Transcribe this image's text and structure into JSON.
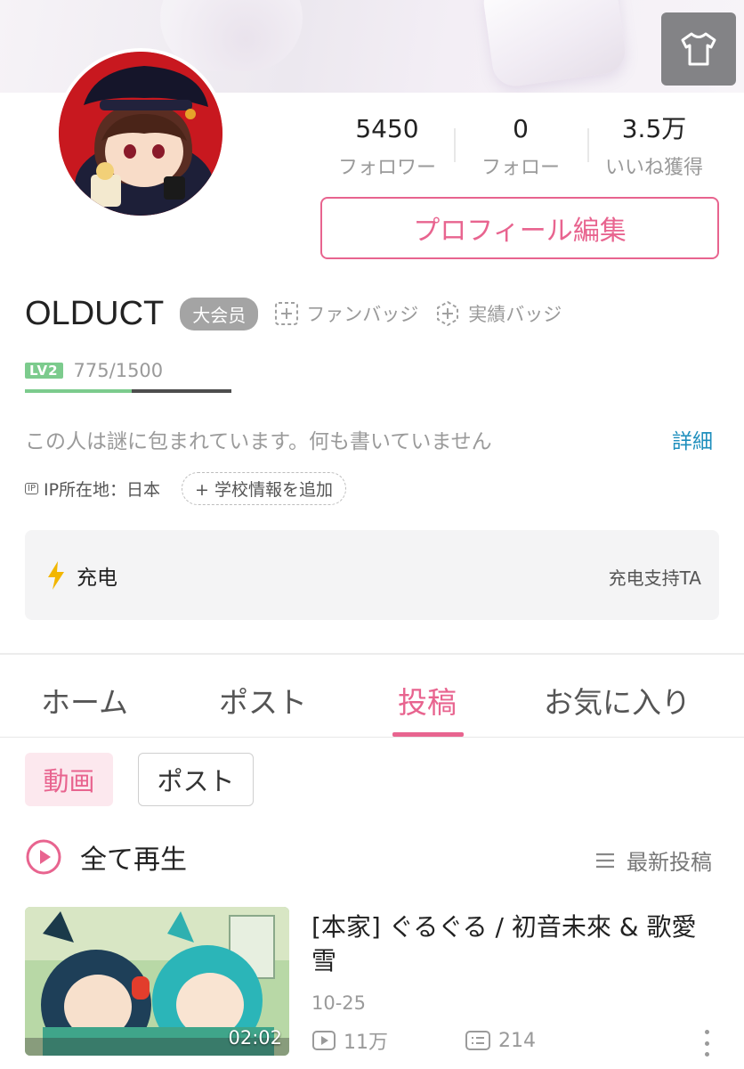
{
  "header": {
    "shirt_icon": "tshirt-icon"
  },
  "profile": {
    "stats": [
      {
        "value": "5450",
        "label": "フォロワー"
      },
      {
        "value": "0",
        "label": "フォロー"
      },
      {
        "value": "3.5万",
        "label": "いいね獲得"
      }
    ],
    "edit_button": "プロフィール編集",
    "username": "OLDUCT",
    "vip_badge": "大会员",
    "fan_badge": "ファンバッジ",
    "achievement_badge": "実績バッジ",
    "level_tag": "LV2",
    "exp": "775/1500",
    "exp_progress": 0.517,
    "bio": "この人は謎に包まれています。何も書いていません",
    "detail_link": "詳細",
    "ip_icon": "IP",
    "ip_location": "IP所在地：日本",
    "school_button": "+ 学校情報を追加"
  },
  "charge": {
    "label": "充电",
    "action": "充电支持TA",
    "accent": "#f2b600"
  },
  "tabs": [
    {
      "label": "ホーム",
      "active": false
    },
    {
      "label": "ポスト",
      "active": false
    },
    {
      "label": "投稿",
      "active": true
    },
    {
      "label": "お気に入り",
      "active": false
    }
  ],
  "filters": {
    "video": "動画",
    "post": "ポスト"
  },
  "list": {
    "play_all": "全て再生",
    "sort": "最新投稿"
  },
  "video": {
    "title": "[本家] ぐるぐる / 初音未來 & 歌愛雪",
    "duration": "02:02",
    "date": "10-25",
    "views": "11万",
    "comments": "214"
  },
  "colors": {
    "accent": "#e8648f",
    "link": "#1f8fbd",
    "level": "#7ccb8d"
  }
}
